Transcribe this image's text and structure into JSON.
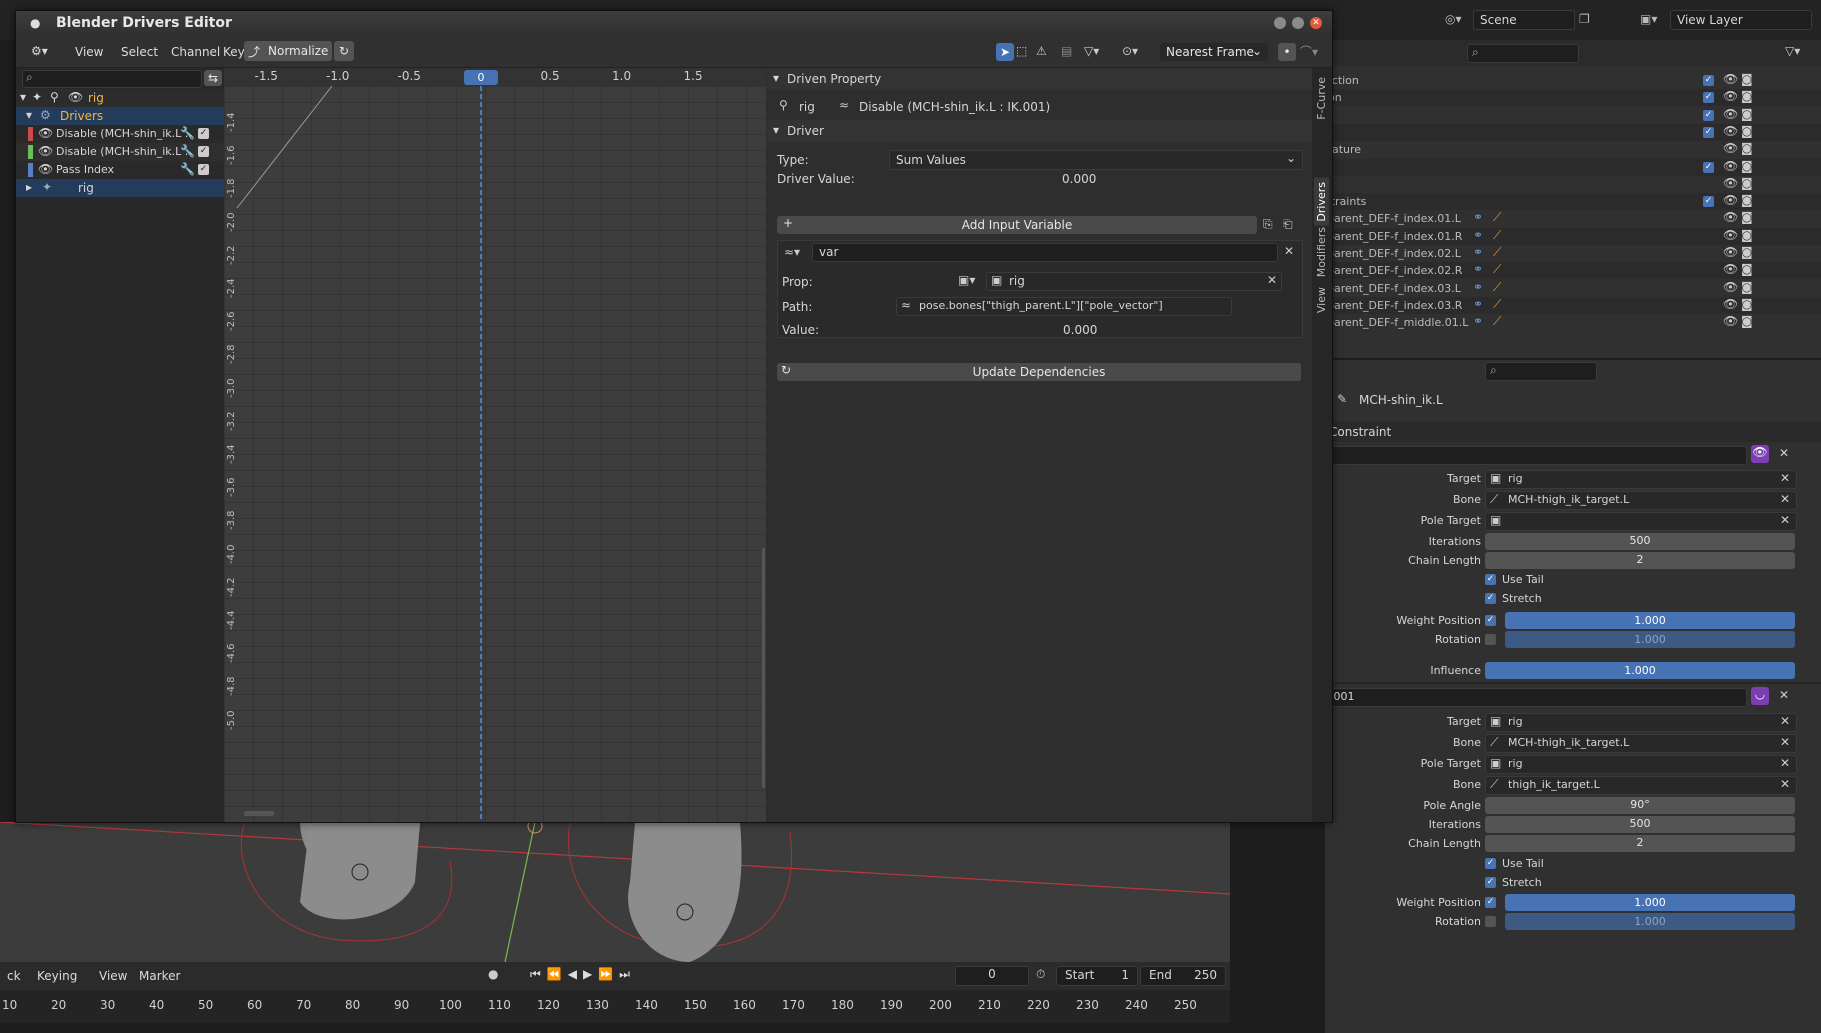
{
  "window": {
    "title": "Blender Drivers Editor"
  },
  "header": {
    "menus": [
      "View",
      "Select",
      "Channel",
      "Key"
    ],
    "normalize_label": "Normalize",
    "snap_mode": "Nearest Frame"
  },
  "graph": {
    "x_ticks": [
      "-1.5",
      "-1.0",
      "-0.5",
      "0",
      "0.5",
      "1.0",
      "1.5"
    ],
    "current_frame": "0",
    "y_ticks": [
      "-1.4",
      "-1.6",
      "-1.8",
      "-2.0",
      "-2.2",
      "-2.4",
      "-2.6",
      "-2.8",
      "-3.0",
      "-3.2",
      "-3.4",
      "-3.6",
      "-3.8",
      "-4.0",
      "-4.2",
      "-4.4",
      "-4.6",
      "-4.8",
      "-5.0"
    ]
  },
  "channels": {
    "root": "rig",
    "drivers_label": "Drivers",
    "items": [
      {
        "label": "Disable (MCH-shin_ik.L :",
        "color": "#c94c4c"
      },
      {
        "label": "Disable (MCH-shin_ik.L :",
        "color": "#6abf5a"
      },
      {
        "label": "Pass Index",
        "color": "#5b7fc7"
      }
    ],
    "sub_rig": "rig"
  },
  "tabs": [
    "F-Curve",
    "Drivers",
    "Modifiers",
    "View"
  ],
  "driven_property": {
    "header": "Driven Property",
    "object": "rig",
    "property": "Disable (MCH-shin_ik.L : IK.001)"
  },
  "driver": {
    "header": "Driver",
    "type_label": "Type:",
    "type_value": "Sum Values",
    "value_label": "Driver Value:",
    "value": "0.000",
    "add_var_label": "Add Input Variable",
    "var_name": "var",
    "prop_label": "Prop:",
    "prop_value": "rig",
    "path_label": "Path:",
    "path_value": "pose.bones[\"thigh_parent.L\"][\"pole_vector\"]",
    "var_value_label": "Value:",
    "var_value": "0.000",
    "update_label": "Update Dependencies"
  },
  "top_right": {
    "scene": "Scene",
    "view_layer": "View Layer"
  },
  "outliner": {
    "rows": [
      "ection",
      "ion",
      "",
      "",
      "nature",
      "n",
      "",
      "straints",
      "parent_DEF-f_index.01.L",
      "parent_DEF-f_index.01.R",
      "parent_DEF-f_index.02.L",
      "parent_DEF-f_index.02.R",
      "parent_DEF-f_index.03.L",
      "parent_DEF-f_index.03.R",
      "parent_DEF-f_middle.01.L"
    ]
  },
  "props": {
    "bone_name": "MCH-shin_ik.L",
    "section": "Constraint",
    "c1": {
      "target_label": "Target",
      "target": "rig",
      "bone_label": "Bone",
      "bone": "MCH-thigh_ik_target.L",
      "pole_label": "Pole Target",
      "iter_label": "Iterations",
      "iterations": "500",
      "chain_label": "Chain Length",
      "chain": "2",
      "use_tail": "Use Tail",
      "stretch": "Stretch",
      "wpos_label": "Weight Position",
      "wpos": "1.000",
      "rot_label": "Rotation",
      "rot": "1.000",
      "infl_label": "Influence",
      "infl": "1.000"
    },
    "c2": {
      "name": ".001",
      "target_label": "Target",
      "target": "rig",
      "bone_label": "Bone",
      "bone": "MCH-thigh_ik_target.L",
      "pole_label": "Pole Target",
      "pole": "rig",
      "pbone_label": "Bone",
      "pbone": "thigh_ik_target.L",
      "angle_label": "Pole Angle",
      "angle": "90°",
      "iter_label": "Iterations",
      "iterations": "500",
      "chain_label": "Chain Length",
      "chain": "2",
      "use_tail": "Use Tail",
      "stretch": "Stretch",
      "wpos_label": "Weight Position",
      "wpos": "1.000",
      "rot_label": "Rotation",
      "rot": "1.000"
    }
  },
  "timeline": {
    "menus": [
      "ck",
      "Keying",
      "View",
      "Marker"
    ],
    "current": "0",
    "start_label": "Start",
    "start": "1",
    "end_label": "End",
    "end": "250",
    "ruler": [
      "10",
      "20",
      "30",
      "40",
      "50",
      "60",
      "70",
      "80",
      "90",
      "100",
      "110",
      "120",
      "130",
      "140",
      "150",
      "160",
      "170",
      "180",
      "190",
      "200",
      "210",
      "220",
      "230",
      "240",
      "250"
    ]
  }
}
